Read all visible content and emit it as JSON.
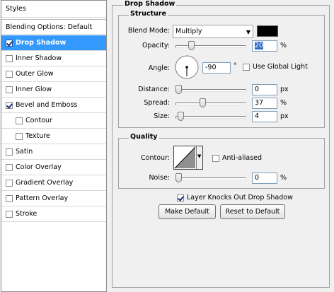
{
  "styles_list": {
    "header": "Styles",
    "blending_options": "Blending Options: Default",
    "items": [
      {
        "label": "Drop Shadow",
        "checked": true,
        "selected": true,
        "indent": false
      },
      {
        "label": "Inner Shadow",
        "checked": false,
        "selected": false,
        "indent": false
      },
      {
        "label": "Outer Glow",
        "checked": false,
        "selected": false,
        "indent": false
      },
      {
        "label": "Inner Glow",
        "checked": false,
        "selected": false,
        "indent": false
      },
      {
        "label": "Bevel and Emboss",
        "checked": true,
        "selected": false,
        "indent": false
      },
      {
        "label": "Contour",
        "checked": false,
        "selected": false,
        "indent": true
      },
      {
        "label": "Texture",
        "checked": false,
        "selected": false,
        "indent": true
      },
      {
        "label": "Satin",
        "checked": false,
        "selected": false,
        "indent": false
      },
      {
        "label": "Color Overlay",
        "checked": false,
        "selected": false,
        "indent": false
      },
      {
        "label": "Gradient Overlay",
        "checked": false,
        "selected": false,
        "indent": false
      },
      {
        "label": "Pattern Overlay",
        "checked": false,
        "selected": false,
        "indent": false
      },
      {
        "label": "Stroke",
        "checked": false,
        "selected": false,
        "indent": false
      }
    ]
  },
  "drop_shadow": {
    "title": "Drop Shadow",
    "structure": {
      "title": "Structure",
      "blend_mode_label": "Blend Mode:",
      "blend_mode_value": "Multiply",
      "shadow_color": "#000000",
      "opacity_label": "Opacity:",
      "opacity_value": "20",
      "opacity_unit": "%",
      "opacity_fraction": 0.2,
      "angle_label": "Angle:",
      "angle_value": "-90",
      "angle_unit": "°",
      "angle_degrees": -90,
      "use_global_light_label": "Use Global Light",
      "use_global_light_checked": false,
      "distance_label": "Distance:",
      "distance_value": "0",
      "distance_unit": "px",
      "distance_fraction": 0.0,
      "spread_label": "Spread:",
      "spread_value": "37",
      "spread_unit": "%",
      "spread_fraction": 0.37,
      "size_label": "Size:",
      "size_value": "4",
      "size_unit": "px",
      "size_fraction": 0.03
    },
    "quality": {
      "title": "Quality",
      "contour_label": "Contour:",
      "anti_aliased_label": "Anti-aliased",
      "anti_aliased_checked": false,
      "noise_label": "Noise:",
      "noise_value": "0",
      "noise_unit": "%",
      "noise_fraction": 0.0
    },
    "knockout_label": "Layer Knocks Out Drop Shadow",
    "knockout_checked": true,
    "make_default_label": "Make Default",
    "reset_default_label": "Reset to Default"
  }
}
